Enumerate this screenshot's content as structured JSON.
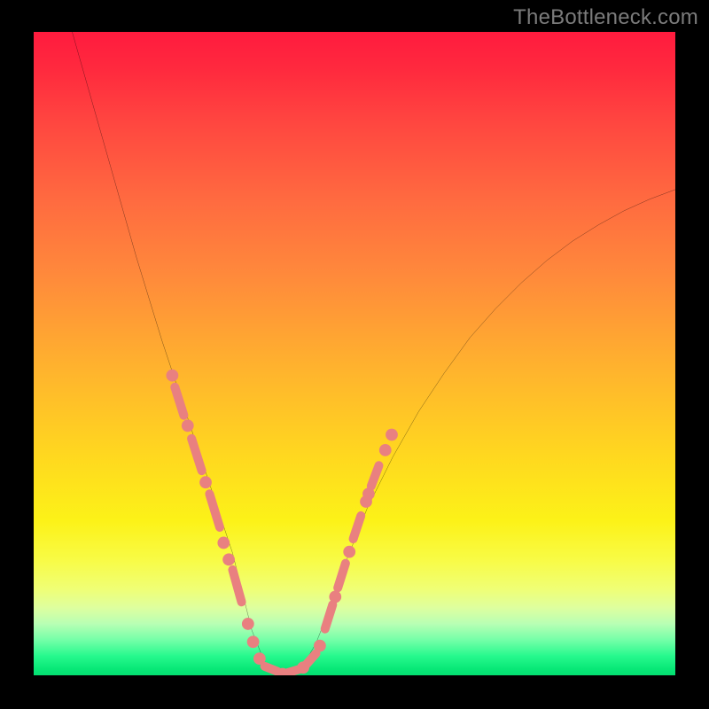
{
  "watermark": "TheBottleneck.com",
  "colors": {
    "background": "#000000",
    "curve_stroke": "#000000",
    "overlay_dot": "#e98080",
    "overlay_dash": "#e98080",
    "gradient_top": "#ff1b3e",
    "gradient_bottom": "#04df71"
  },
  "chart_data": {
    "type": "line",
    "title": "",
    "xlabel": "",
    "ylabel": "",
    "xlim": [
      0,
      100
    ],
    "ylim": [
      0,
      100
    ],
    "grid": false,
    "legend": false,
    "series": [
      {
        "name": "bottleneck-curve",
        "x": [
          6,
          8,
          10,
          12,
          14,
          16,
          18,
          20,
          22,
          24,
          26,
          28,
          30,
          31,
          32,
          33,
          34,
          36,
          38,
          40,
          42,
          44,
          46,
          48,
          52,
          56,
          60,
          64,
          68,
          72,
          76,
          80,
          84,
          88,
          92,
          96,
          100
        ],
        "values": [
          100,
          93,
          86,
          79,
          72,
          65,
          58.5,
          52,
          46,
          40,
          34,
          28,
          22,
          19,
          15,
          11,
          7,
          2,
          0,
          0.5,
          1.5,
          5,
          10,
          16,
          26,
          34,
          41,
          47,
          52.5,
          57,
          61,
          64.5,
          67.5,
          70,
          72.2,
          74,
          75.5
        ]
      }
    ],
    "overlay_markers": {
      "left_branch": {
        "dashes": [
          {
            "x1": 22.0,
            "y1": 44.8,
            "x2": 23.4,
            "y2": 40.4
          },
          {
            "x1": 24.6,
            "y1": 36.8,
            "x2": 26.2,
            "y2": 31.8
          },
          {
            "x1": 27.4,
            "y1": 28.2,
            "x2": 29.0,
            "y2": 23.0
          },
          {
            "x1": 31.0,
            "y1": 16.4,
            "x2": 32.4,
            "y2": 11.4
          }
        ],
        "dots": [
          {
            "x": 21.6,
            "y": 46.6
          },
          {
            "x": 24.0,
            "y": 38.8
          },
          {
            "x": 26.8,
            "y": 30.0
          },
          {
            "x": 29.6,
            "y": 20.6
          },
          {
            "x": 30.4,
            "y": 18.0
          },
          {
            "x": 33.4,
            "y": 8.0
          },
          {
            "x": 34.2,
            "y": 5.2
          }
        ]
      },
      "valley": {
        "dashes": [
          {
            "x1": 36.0,
            "y1": 1.4,
            "x2": 38.0,
            "y2": 0.6
          },
          {
            "x1": 39.6,
            "y1": 0.4,
            "x2": 41.6,
            "y2": 1.0
          },
          {
            "x1": 42.4,
            "y1": 1.6,
            "x2": 44.0,
            "y2": 3.4
          }
        ],
        "dots": [
          {
            "x": 35.2,
            "y": 2.6
          },
          {
            "x": 38.8,
            "y": 0.2
          },
          {
            "x": 42.0,
            "y": 1.2
          },
          {
            "x": 44.6,
            "y": 4.6
          }
        ]
      },
      "right_branch": {
        "dashes": [
          {
            "x1": 45.4,
            "y1": 7.2,
            "x2": 46.6,
            "y2": 11.0
          },
          {
            "x1": 47.4,
            "y1": 13.6,
            "x2": 48.6,
            "y2": 17.4
          },
          {
            "x1": 49.8,
            "y1": 21.2,
            "x2": 51.0,
            "y2": 24.8
          },
          {
            "x1": 52.6,
            "y1": 29.4,
            "x2": 53.8,
            "y2": 32.6
          }
        ],
        "dots": [
          {
            "x": 47.0,
            "y": 12.2
          },
          {
            "x": 49.2,
            "y": 19.2
          },
          {
            "x": 51.8,
            "y": 27.0
          },
          {
            "x": 52.2,
            "y": 28.2
          },
          {
            "x": 54.8,
            "y": 35.0
          },
          {
            "x": 55.8,
            "y": 37.4
          }
        ]
      }
    }
  }
}
